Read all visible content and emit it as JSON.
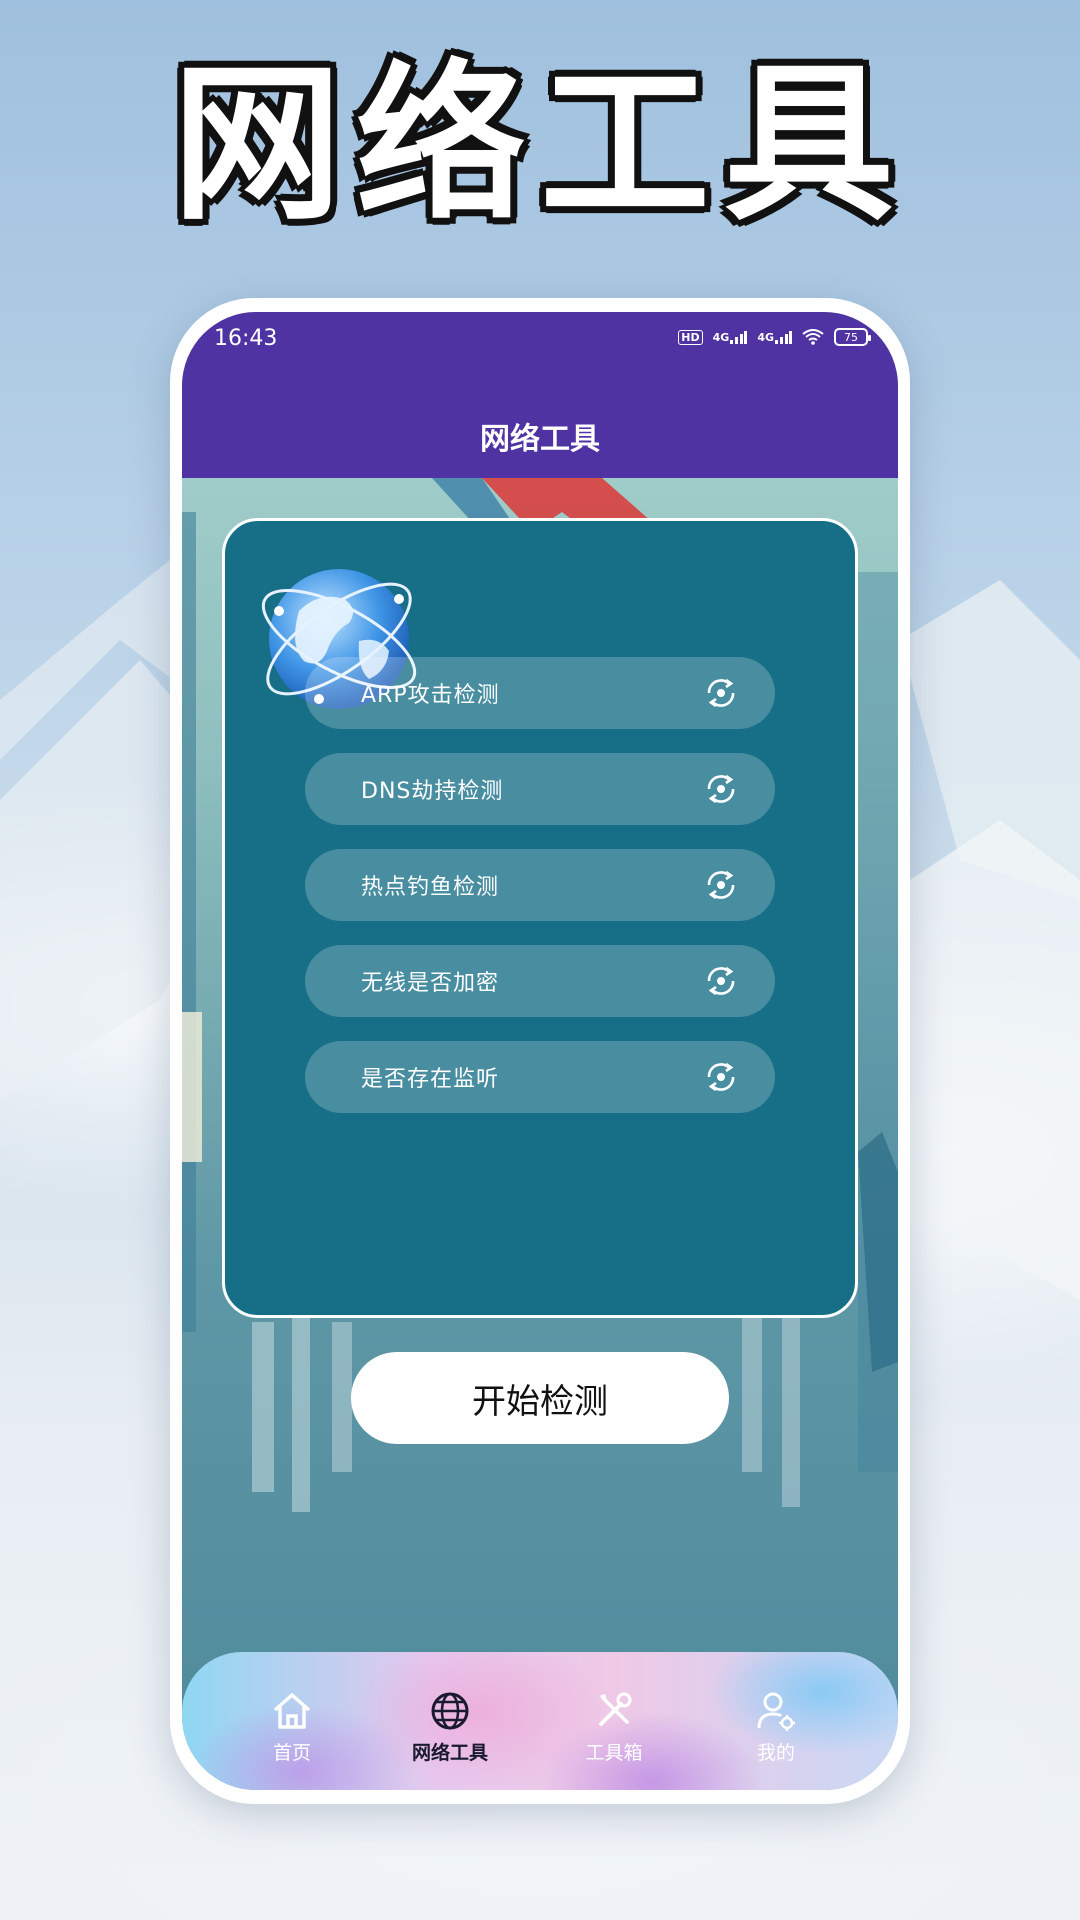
{
  "hero": {
    "title": "网络工具"
  },
  "statusbar": {
    "time": "16:43",
    "hd": "HD",
    "sim1": "4G",
    "sim2": "4G",
    "battery": "75"
  },
  "appbar": {
    "title": "网络工具"
  },
  "checks": [
    {
      "label": "ARP攻击检测",
      "icon": "refresh-icon"
    },
    {
      "label": "DNS劫持检测",
      "icon": "refresh-icon"
    },
    {
      "label": "热点钓鱼检测",
      "icon": "refresh-icon"
    },
    {
      "label": "无线是否加密",
      "icon": "refresh-icon"
    },
    {
      "label": "是否存在监听",
      "icon": "refresh-icon"
    }
  ],
  "start_button": {
    "label": "开始检测"
  },
  "tabs": [
    {
      "label": "首页",
      "icon": "home-icon"
    },
    {
      "label": "网络工具",
      "icon": "globe-icon",
      "active": true
    },
    {
      "label": "工具箱",
      "icon": "tools-icon"
    },
    {
      "label": "我的",
      "icon": "user-settings-icon"
    }
  ],
  "colors": {
    "appbar": "#4f33a3",
    "panel": "#166e87",
    "accent_red": "#d8403f"
  }
}
